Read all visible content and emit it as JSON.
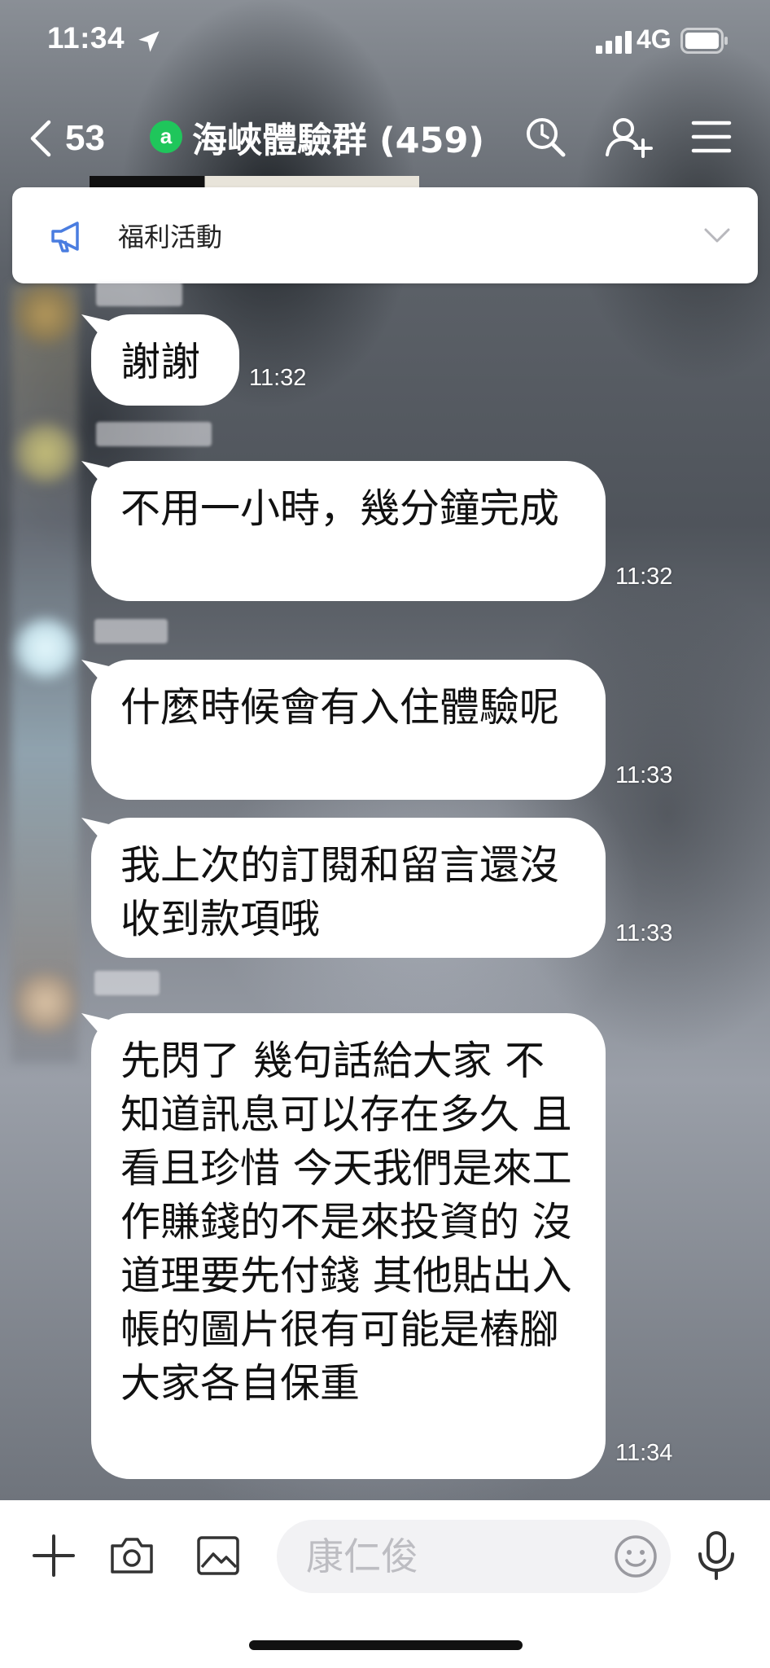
{
  "status_bar": {
    "time": "11:34",
    "network": "4G"
  },
  "nav": {
    "back_count": "53",
    "open_chat_badge": "a",
    "title": "海峽體驗群 (459)"
  },
  "announcement": {
    "text": "福利活動"
  },
  "messages": [
    {
      "text": "謝謝",
      "time": "11:32"
    },
    {
      "text": "不用一小時，幾分鐘完成",
      "time": "11:32"
    },
    {
      "text": "什麼時候會有入住體驗呢",
      "time": "11:33"
    },
    {
      "text": "我上次的訂閱和留言還沒收到款項哦",
      "time": "11:33"
    },
    {
      "text": "先閃了  幾句話給大家 不知道訊息可以存在多久  且看且珍惜  今天我們是來工作賺錢的不是來投資的  沒道理要先付錢  其他貼出入帳的圖片很有可能是樁腳 大家各自保重",
      "time": "11:34"
    }
  ],
  "input": {
    "placeholder": "康仁俊"
  },
  "icons": {
    "location": "location-arrow-icon",
    "signal": "signal-bars-icon",
    "battery": "battery-icon",
    "back": "chevron-left-icon",
    "search": "search-icon",
    "add_friend": "add-friend-icon",
    "menu": "hamburger-menu-icon",
    "announcement": "megaphone-icon",
    "expand": "chevron-down-icon",
    "plus": "plus-icon",
    "camera": "camera-icon",
    "image": "image-icon",
    "emoji": "emoji-icon",
    "mic": "microphone-icon"
  },
  "colors": {
    "badge_green": "#1fc65b",
    "bubble_bg": "#ffffff",
    "accent_blue": "#4a7de0"
  }
}
